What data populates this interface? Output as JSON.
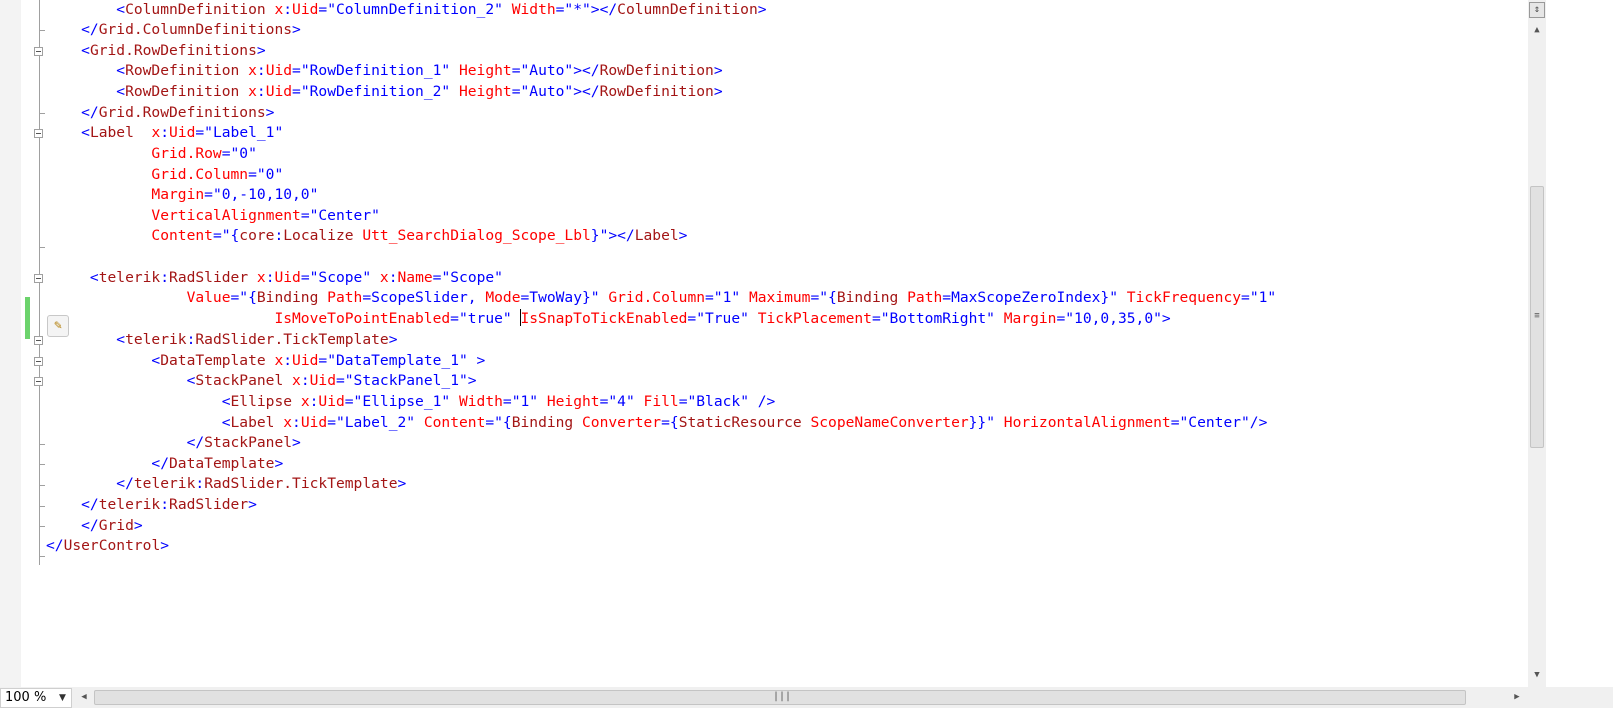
{
  "zoom": {
    "value": "100 %"
  },
  "icons": {
    "split": "split-handle-icon",
    "status": "status-indicator-icon",
    "edit": "pencil-icon",
    "scroll_up": "chevron-up-icon",
    "scroll_down": "chevron-down-icon",
    "scroll_left": "chevron-left-icon",
    "scroll_right": "chevron-right-icon"
  },
  "colors": {
    "element": "#a31515",
    "attribute": "#ff0000",
    "punctuation": "#0000ff",
    "changed_line": "#6cd36c",
    "status_ok": "#2ec62e"
  },
  "lines": [
    [
      [
        "b",
        "        <"
      ],
      [
        "m",
        "ColumnDefinition"
      ],
      [
        "r",
        " x"
      ],
      [
        "b",
        ":"
      ],
      [
        "r",
        "Uid"
      ],
      [
        "b",
        "=\"ColumnDefinition_2\""
      ],
      [
        "r",
        " Width"
      ],
      [
        "b",
        "=\"*\"></"
      ],
      [
        "m",
        "ColumnDefinition"
      ],
      [
        "b",
        ">"
      ]
    ],
    [
      [
        "b",
        "    </"
      ],
      [
        "m",
        "Grid.ColumnDefinitions"
      ],
      [
        "b",
        ">"
      ]
    ],
    [
      [
        "b",
        "    <"
      ],
      [
        "m",
        "Grid.RowDefinitions"
      ],
      [
        "b",
        ">"
      ]
    ],
    [
      [
        "b",
        "        <"
      ],
      [
        "m",
        "RowDefinition"
      ],
      [
        "r",
        " x"
      ],
      [
        "b",
        ":"
      ],
      [
        "r",
        "Uid"
      ],
      [
        "b",
        "=\"RowDefinition_1\""
      ],
      [
        "r",
        " Height"
      ],
      [
        "b",
        "=\"Auto\"></"
      ],
      [
        "m",
        "RowDefinition"
      ],
      [
        "b",
        ">"
      ]
    ],
    [
      [
        "b",
        "        <"
      ],
      [
        "m",
        "RowDefinition"
      ],
      [
        "r",
        " x"
      ],
      [
        "b",
        ":"
      ],
      [
        "r",
        "Uid"
      ],
      [
        "b",
        "=\"RowDefinition_2\""
      ],
      [
        "r",
        " Height"
      ],
      [
        "b",
        "=\"Auto\"></"
      ],
      [
        "m",
        "RowDefinition"
      ],
      [
        "b",
        ">"
      ]
    ],
    [
      [
        "b",
        "    </"
      ],
      [
        "m",
        "Grid.RowDefinitions"
      ],
      [
        "b",
        ">"
      ]
    ],
    [
      [
        "b",
        "    <"
      ],
      [
        "m",
        "Label"
      ],
      [
        "r",
        "  x"
      ],
      [
        "b",
        ":"
      ],
      [
        "r",
        "Uid"
      ],
      [
        "b",
        "=\"Label_1\""
      ]
    ],
    [
      [
        "r",
        "            Grid.Row"
      ],
      [
        "b",
        "=\"0\""
      ]
    ],
    [
      [
        "r",
        "            Grid.Column"
      ],
      [
        "b",
        "=\"0\""
      ]
    ],
    [
      [
        "r",
        "            Margin"
      ],
      [
        "b",
        "=\"0,-10,10,0\""
      ]
    ],
    [
      [
        "r",
        "            VerticalAlignment"
      ],
      [
        "b",
        "=\"Center\""
      ]
    ],
    [
      [
        "r",
        "            Content"
      ],
      [
        "b",
        "=\"{"
      ],
      [
        "m",
        "core"
      ],
      [
        "b",
        ":"
      ],
      [
        "m",
        "Localize"
      ],
      [
        "r",
        " Utt_SearchDialog_Scope_Lbl"
      ],
      [
        "b",
        "}\"></"
      ],
      [
        "m",
        "Label"
      ],
      [
        "b",
        ">"
      ]
    ],
    [],
    [
      [
        "b",
        "     <"
      ],
      [
        "m",
        "telerik"
      ],
      [
        "b",
        ":"
      ],
      [
        "m",
        "RadSlider"
      ],
      [
        "r",
        " x"
      ],
      [
        "b",
        ":"
      ],
      [
        "r",
        "Uid"
      ],
      [
        "b",
        "=\"Scope\""
      ],
      [
        "r",
        " x"
      ],
      [
        "b",
        ":"
      ],
      [
        "r",
        "Name"
      ],
      [
        "b",
        "=\"Scope\""
      ]
    ],
    [
      [
        "r",
        "                Value"
      ],
      [
        "b",
        "=\"{"
      ],
      [
        "m",
        "Binding"
      ],
      [
        "r",
        " Path"
      ],
      [
        "b",
        "=ScopeSlider,"
      ],
      [
        "r",
        " Mode"
      ],
      [
        "b",
        "=TwoWay}\""
      ],
      [
        "r",
        " Grid.Column"
      ],
      [
        "b",
        "=\"1\""
      ],
      [
        "r",
        " Maximum"
      ],
      [
        "b",
        "=\"{"
      ],
      [
        "m",
        "Binding"
      ],
      [
        "r",
        " Path"
      ],
      [
        "b",
        "=MaxScopeZeroIndex}\""
      ],
      [
        "r",
        " TickFrequency"
      ],
      [
        "b",
        "=\"1\""
      ]
    ],
    [
      [
        "r",
        "                          IsMoveToPointEnabled"
      ],
      [
        "b",
        "=\"true\" "
      ],
      [
        "caret",
        ""
      ],
      [
        "r",
        "IsSnapToTickEnabled"
      ],
      [
        "b",
        "=\"True\""
      ],
      [
        "r",
        " TickPlacement"
      ],
      [
        "b",
        "=\"BottomRight\""
      ],
      [
        "r",
        " Margin"
      ],
      [
        "b",
        "=\"10,0,35,0\">"
      ]
    ],
    [
      [
        "b",
        "        <"
      ],
      [
        "m",
        "telerik"
      ],
      [
        "b",
        ":"
      ],
      [
        "m",
        "RadSlider.TickTemplate"
      ],
      [
        "b",
        ">"
      ]
    ],
    [
      [
        "b",
        "            <"
      ],
      [
        "m",
        "DataTemplate"
      ],
      [
        "r",
        " x"
      ],
      [
        "b",
        ":"
      ],
      [
        "r",
        "Uid"
      ],
      [
        "b",
        "=\"DataTemplate_1\" >"
      ]
    ],
    [
      [
        "b",
        "                <"
      ],
      [
        "m",
        "StackPanel"
      ],
      [
        "r",
        " x"
      ],
      [
        "b",
        ":"
      ],
      [
        "r",
        "Uid"
      ],
      [
        "b",
        "=\"StackPanel_1\">"
      ]
    ],
    [
      [
        "b",
        "                    <"
      ],
      [
        "m",
        "Ellipse"
      ],
      [
        "r",
        " x"
      ],
      [
        "b",
        ":"
      ],
      [
        "r",
        "Uid"
      ],
      [
        "b",
        "=\"Ellipse_1\""
      ],
      [
        "r",
        " Width"
      ],
      [
        "b",
        "=\"1\""
      ],
      [
        "r",
        " Height"
      ],
      [
        "b",
        "=\"4\""
      ],
      [
        "r",
        " Fill"
      ],
      [
        "b",
        "=\"Black\" />"
      ]
    ],
    [
      [
        "b",
        "                    <"
      ],
      [
        "m",
        "Label"
      ],
      [
        "r",
        " x"
      ],
      [
        "b",
        ":"
      ],
      [
        "r",
        "Uid"
      ],
      [
        "b",
        "=\"Label_2\""
      ],
      [
        "r",
        " Content"
      ],
      [
        "b",
        "=\"{"
      ],
      [
        "m",
        "Binding"
      ],
      [
        "r",
        " Converter"
      ],
      [
        "b",
        "={"
      ],
      [
        "m",
        "StaticResource"
      ],
      [
        "r",
        " ScopeNameConverter"
      ],
      [
        "b",
        "}}\""
      ],
      [
        "r",
        " HorizontalAlignment"
      ],
      [
        "b",
        "=\"Center\"/>"
      ]
    ],
    [
      [
        "b",
        "                </"
      ],
      [
        "m",
        "StackPanel"
      ],
      [
        "b",
        ">"
      ]
    ],
    [
      [
        "b",
        "            </"
      ],
      [
        "m",
        "DataTemplate"
      ],
      [
        "b",
        ">"
      ]
    ],
    [
      [
        "b",
        "        </"
      ],
      [
        "m",
        "telerik"
      ],
      [
        "b",
        ":"
      ],
      [
        "m",
        "RadSlider.TickTemplate"
      ],
      [
        "b",
        ">"
      ]
    ],
    [
      [
        "b",
        "    </"
      ],
      [
        "m",
        "telerik"
      ],
      [
        "b",
        ":"
      ],
      [
        "m",
        "RadSlider"
      ],
      [
        "b",
        ">"
      ]
    ],
    [
      [
        "b",
        "    </"
      ],
      [
        "m",
        "Grid"
      ],
      [
        "b",
        ">"
      ]
    ],
    [
      [
        "b",
        "</"
      ],
      [
        "m",
        "UserControl"
      ],
      [
        "b",
        ">"
      ]
    ]
  ]
}
